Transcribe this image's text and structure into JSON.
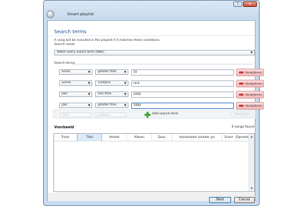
{
  "window": {
    "title": "Smart playlist",
    "help": "?",
    "close": "✕"
  },
  "header": {
    "section_title": "Search terms",
    "hint": "A song will be included in the playlist if it matches these conditions.",
    "mode_label": "Search mode",
    "mode_value": "Match every search term (AND)"
  },
  "terms": {
    "label": "Search terms",
    "rows": [
      {
        "field": "Score",
        "operator": "greater than",
        "value": "50",
        "remove": "Verwijderen"
      },
      {
        "field": "Genre",
        "operator": "contains",
        "value": "rock",
        "remove": "Verwijderen"
      },
      {
        "field": "Jaar",
        "operator": "less than",
        "value": "2000",
        "remove": "Verwijderen"
      },
      {
        "field": "Jaar",
        "operator": "greater than",
        "value": "1990",
        "remove": "Verwijderen"
      }
    ],
    "ghost": {
      "field": "Titel",
      "operator": "contains",
      "remove": "Verwijderen"
    },
    "add_label": "Add search term"
  },
  "preview": {
    "label": "Voorbeeld",
    "count": "0 songs found",
    "columns": [
      "Track",
      "Titel",
      "Artiest",
      "Album",
      "Duur",
      "standnaam (zonder pa",
      "Score",
      "Opmerking"
    ],
    "sorted_column": "Titel"
  },
  "footer": {
    "next": "Next",
    "cancel": "Cancel"
  }
}
